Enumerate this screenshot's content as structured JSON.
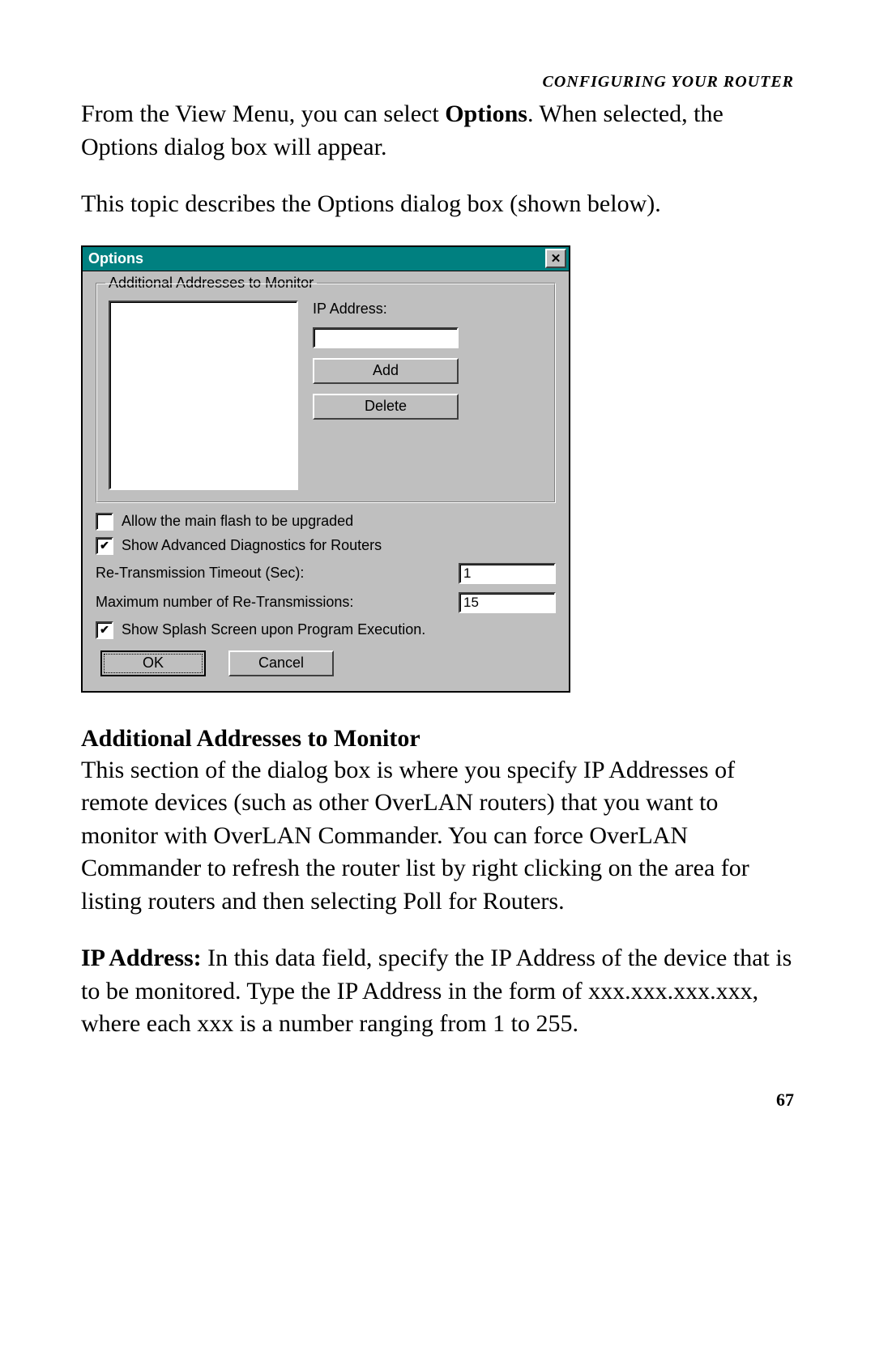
{
  "header": "CONFIGURING YOUR ROUTER",
  "intro": {
    "pre": "From the View Menu, you can select ",
    "bold": "Options",
    "post": ".  When selected, the Options dialog box will appear."
  },
  "topic_line": "This topic describes the Options dialog box (shown below).",
  "dialog": {
    "title": "Options",
    "close_glyph": "✕",
    "group_legend": "Additional Addresses to Monitor",
    "ip_label": "IP Address:",
    "ip_value": "",
    "add_label": "Add",
    "delete_label": "Delete",
    "allow_flash": {
      "checked": false,
      "label": "Allow the main flash to be upgraded"
    },
    "show_diag": {
      "checked": true,
      "label": "Show Advanced Diagnostics for Routers"
    },
    "retrans_timeout": {
      "label": "Re-Transmission Timeout (Sec):",
      "value": "1"
    },
    "max_retrans": {
      "label": "Maximum number of Re-Transmissions:",
      "value": "15"
    },
    "show_splash": {
      "checked": true,
      "label": "Show Splash Screen upon Program Execution."
    },
    "ok_label": "OK",
    "cancel_label": "Cancel"
  },
  "subhead1": "Additional Addresses to Monitor",
  "sub1_body": "This section of the dialog box is where you specify IP Addresses of remote devices (such as other OverLAN routers) that you want to monitor with OverLAN Commander.  You can force OverLAN Commander to refresh the router list by right clicking on the area for listing routers and then selecting Poll for Routers.",
  "ip_section": {
    "lead": "IP Address:",
    "body": "  In this data field, specify the IP Address of the device that is to be monitored.  Type the IP Address in the form of xxx.xxx.xxx.xxx, where each xxx is a number ranging from 1 to 255."
  },
  "page_number": "67",
  "check_glyph": "✔"
}
